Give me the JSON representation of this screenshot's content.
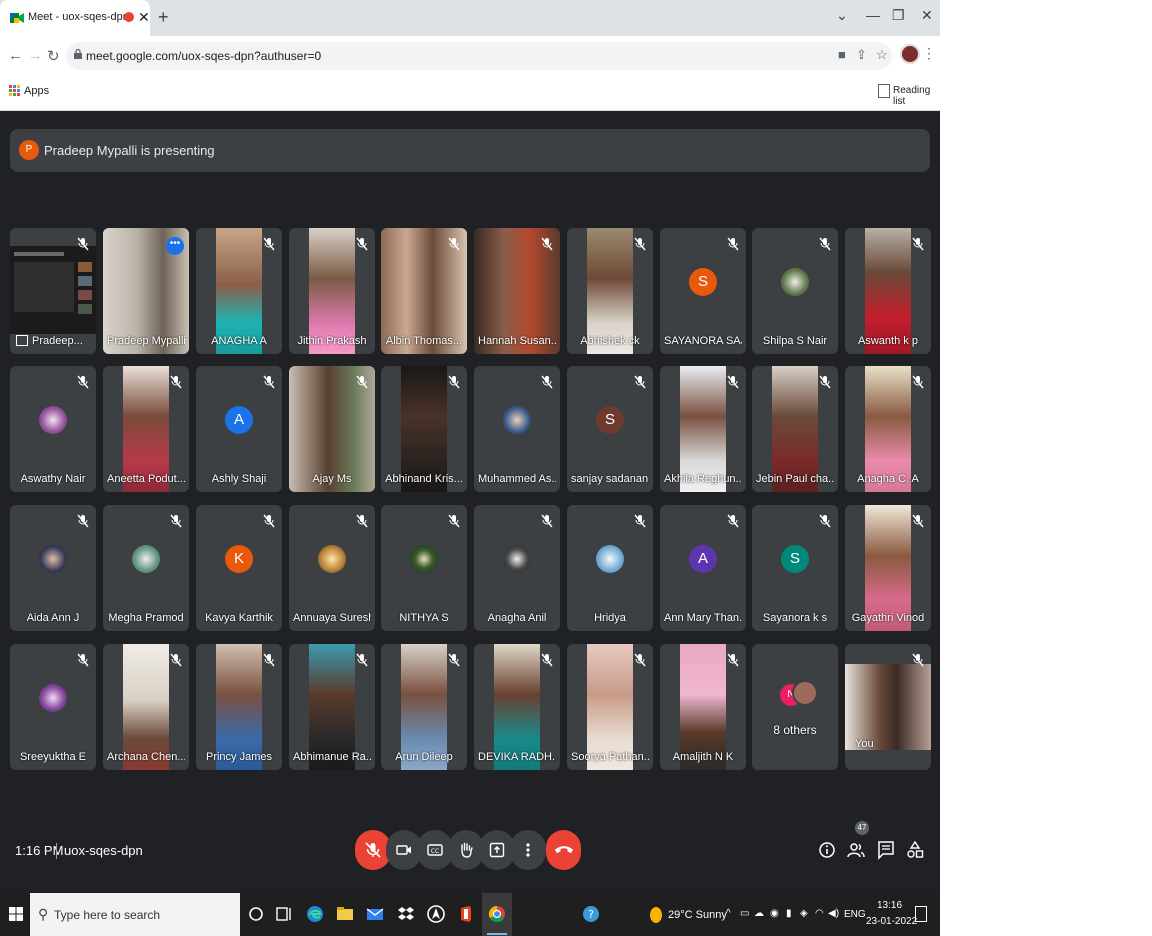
{
  "browser": {
    "tab_title": "Meet - uox-sqes-dpn",
    "url": "meet.google.com/uox-sqes-dpn?authuser=0",
    "bookmark_apps": "Apps",
    "reading_list": "Reading list"
  },
  "meet": {
    "presenting_initial": "P",
    "presenting_banner": "Pradeep Mypalli is presenting",
    "participants_row1": [
      "Pradeep...",
      "Pradeep Mypalli",
      "ANAGHA A",
      "Jithin Prakash",
      "Albin Thomas...",
      "Hannah Susan...",
      "Abhishek ck",
      "SAYANORA SAJ...",
      "Shilpa S Nair",
      "Aswanth k p"
    ],
    "participants_row2": [
      "Aswathy Nair",
      "Aneetta Podut...",
      "Ashly Shaji",
      "Ajay Ms",
      "Abhinand Kris...",
      "Muhammed As...",
      "sanjay sadanan...",
      "Akhila Reghun...",
      "Jebin Paul cha...",
      "Anagha C. A"
    ],
    "participants_row3": [
      "Aida Ann J",
      "Megha Pramod",
      "Kavya Karthik",
      "Annuaya Suresh",
      "NITHYA S",
      "Anagha Anil",
      "Hridya",
      "Ann Mary Than...",
      "Sayanora k s",
      "Gayathri Vinod"
    ],
    "participants_row4": [
      "Sreeyuktha E",
      "Archana Chen...",
      "Princy James",
      "Abhimanue Ra...",
      "Arun Dileep",
      "DEVIKA RADH...",
      "Soorya Pathan...",
      "Amaljith N K",
      "8 others",
      "You"
    ],
    "avatar_letters": {
      "sayanora_saj": "S",
      "ashly": "A",
      "sanjay": "S",
      "kavya": "K",
      "ann_mary": "A",
      "sayanora_ks": "S",
      "others": "N"
    },
    "time": "1:16 PM",
    "meeting_code": "uox-sqes-dpn",
    "participant_count": "47",
    "colors": {
      "meet_bg": "#202124",
      "tile_bg": "#3c4043",
      "red": "#ea4335",
      "accent": "#8ab4f8"
    }
  },
  "taskbar": {
    "search_placeholder": "Type here to search",
    "weather": "29°C  Sunny",
    "language": "ENG",
    "time": "13:16",
    "date": "23-01-2022"
  }
}
